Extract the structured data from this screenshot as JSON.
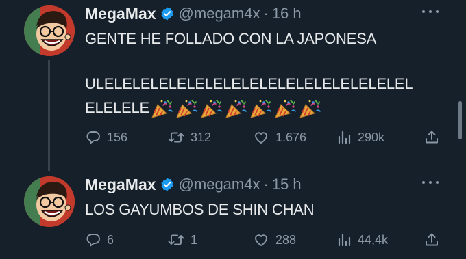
{
  "colors": {
    "background": "#15202b",
    "text": "#e7e9ea",
    "muted": "#8b98a5",
    "verified": "#1d9bf0"
  },
  "tweets": [
    {
      "author": {
        "display_name": "MegaMax",
        "handle": "@megam4x",
        "separator": "·",
        "time": "16 h",
        "verified": true
      },
      "lines": [
        "GENTE HE FOLLADO CON LA JAPONESA",
        "ULELELELELELELELELELELELELELELELELEL",
        "ELELELE"
      ],
      "emoji": {
        "name": "party-popper-icon",
        "count": 7
      },
      "actions": {
        "replies": "156",
        "retweets": "312",
        "likes": "1.676",
        "views": "290k"
      },
      "icons": [
        "reply-icon",
        "retweet-icon",
        "like-icon",
        "views-icon",
        "share-icon",
        "more-icon"
      ]
    },
    {
      "author": {
        "display_name": "MegaMax",
        "handle": "@megam4x",
        "separator": "·",
        "time": "15 h",
        "verified": true
      },
      "lines": [
        "LOS GAYUMBOS DE SHIN CHAN"
      ],
      "actions": {
        "replies": "6",
        "retweets": "1",
        "likes": "288",
        "views": "44,4k"
      },
      "icons": [
        "reply-icon",
        "retweet-icon",
        "like-icon",
        "views-icon",
        "share-icon",
        "more-icon"
      ]
    }
  ]
}
